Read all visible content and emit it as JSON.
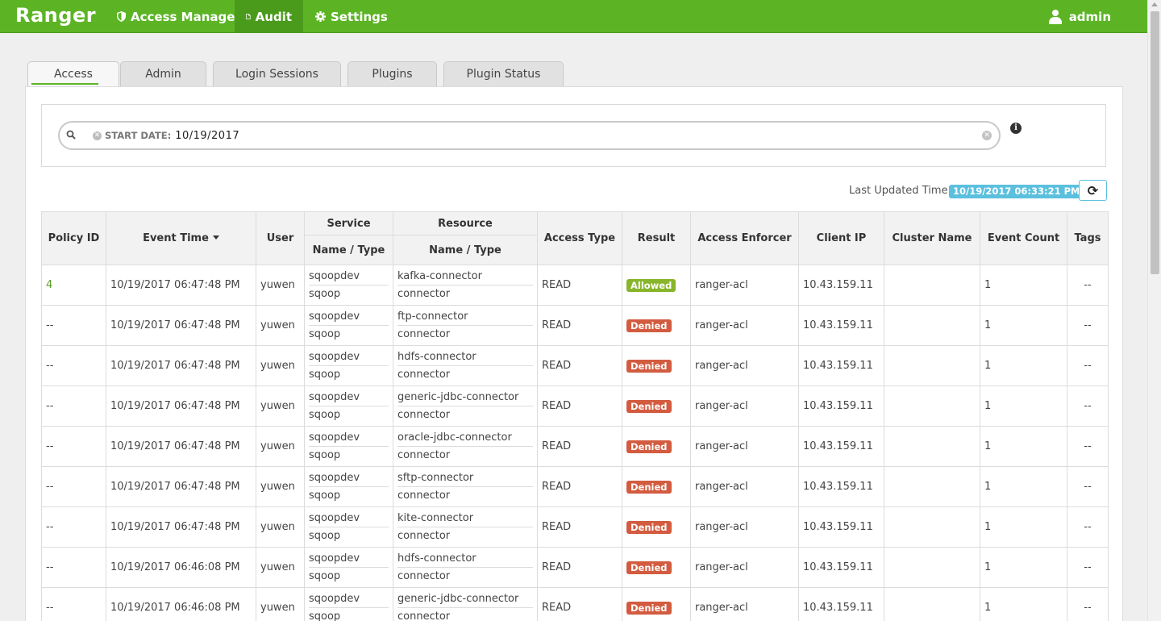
{
  "nav": {
    "brand": "Ranger",
    "items": [
      {
        "label": "Access Manager",
        "icon": "shield-icon"
      },
      {
        "label": "Audit",
        "icon": "file-icon"
      },
      {
        "label": "Settings",
        "icon": "gear-icon"
      }
    ],
    "user": "admin"
  },
  "tabs": [
    "Access",
    "Admin",
    "Login Sessions",
    "Plugins",
    "Plugin Status"
  ],
  "search": {
    "facet_category": "START DATE:",
    "facet_value": "10/19/2017"
  },
  "status": {
    "last_updated_label": "Last Updated Time :",
    "last_updated_value": "10/19/2017 06:33:21 PM"
  },
  "table": {
    "headers": {
      "policy_id": "Policy ID",
      "event_time": "Event Time",
      "user": "User",
      "service": "Service",
      "service_sub": "Name / Type",
      "resource": "Resource",
      "resource_sub": "Name / Type",
      "access_type": "Access Type",
      "result": "Result",
      "access_enforcer": "Access Enforcer",
      "client_ip": "Client IP",
      "cluster_name": "Cluster Name",
      "event_count": "Event Count",
      "tags": "Tags"
    },
    "rows": [
      {
        "policy_id": "4",
        "event_time": "10/19/2017 06:47:48 PM",
        "user": "yuwen",
        "service_name": "sqoopdev",
        "service_type": "sqoop",
        "resource_name": "kafka-connector",
        "resource_type": "connector",
        "access_type": "READ",
        "result": "Allowed",
        "enforcer": "ranger-acl",
        "client_ip": "10.43.159.11",
        "cluster": "",
        "count": "1",
        "tags": "--"
      },
      {
        "policy_id": "--",
        "event_time": "10/19/2017 06:47:48 PM",
        "user": "yuwen",
        "service_name": "sqoopdev",
        "service_type": "sqoop",
        "resource_name": "ftp-connector",
        "resource_type": "connector",
        "access_type": "READ",
        "result": "Denied",
        "enforcer": "ranger-acl",
        "client_ip": "10.43.159.11",
        "cluster": "",
        "count": "1",
        "tags": "--"
      },
      {
        "policy_id": "--",
        "event_time": "10/19/2017 06:47:48 PM",
        "user": "yuwen",
        "service_name": "sqoopdev",
        "service_type": "sqoop",
        "resource_name": "hdfs-connector",
        "resource_type": "connector",
        "access_type": "READ",
        "result": "Denied",
        "enforcer": "ranger-acl",
        "client_ip": "10.43.159.11",
        "cluster": "",
        "count": "1",
        "tags": "--"
      },
      {
        "policy_id": "--",
        "event_time": "10/19/2017 06:47:48 PM",
        "user": "yuwen",
        "service_name": "sqoopdev",
        "service_type": "sqoop",
        "resource_name": "generic-jdbc-connector",
        "resource_type": "connector",
        "access_type": "READ",
        "result": "Denied",
        "enforcer": "ranger-acl",
        "client_ip": "10.43.159.11",
        "cluster": "",
        "count": "1",
        "tags": "--"
      },
      {
        "policy_id": "--",
        "event_time": "10/19/2017 06:47:48 PM",
        "user": "yuwen",
        "service_name": "sqoopdev",
        "service_type": "sqoop",
        "resource_name": "oracle-jdbc-connector",
        "resource_type": "connector",
        "access_type": "READ",
        "result": "Denied",
        "enforcer": "ranger-acl",
        "client_ip": "10.43.159.11",
        "cluster": "",
        "count": "1",
        "tags": "--"
      },
      {
        "policy_id": "--",
        "event_time": "10/19/2017 06:47:48 PM",
        "user": "yuwen",
        "service_name": "sqoopdev",
        "service_type": "sqoop",
        "resource_name": "sftp-connector",
        "resource_type": "connector",
        "access_type": "READ",
        "result": "Denied",
        "enforcer": "ranger-acl",
        "client_ip": "10.43.159.11",
        "cluster": "",
        "count": "1",
        "tags": "--"
      },
      {
        "policy_id": "--",
        "event_time": "10/19/2017 06:47:48 PM",
        "user": "yuwen",
        "service_name": "sqoopdev",
        "service_type": "sqoop",
        "resource_name": "kite-connector",
        "resource_type": "connector",
        "access_type": "READ",
        "result": "Denied",
        "enforcer": "ranger-acl",
        "client_ip": "10.43.159.11",
        "cluster": "",
        "count": "1",
        "tags": "--"
      },
      {
        "policy_id": "--",
        "event_time": "10/19/2017 06:46:08 PM",
        "user": "yuwen",
        "service_name": "sqoopdev",
        "service_type": "sqoop",
        "resource_name": "hdfs-connector",
        "resource_type": "connector",
        "access_type": "READ",
        "result": "Denied",
        "enforcer": "ranger-acl",
        "client_ip": "10.43.159.11",
        "cluster": "",
        "count": "1",
        "tags": "--"
      },
      {
        "policy_id": "--",
        "event_time": "10/19/2017 06:46:08 PM",
        "user": "yuwen",
        "service_name": "sqoopdev",
        "service_type": "sqoop",
        "resource_name": "generic-jdbc-connector",
        "resource_type": "connector",
        "access_type": "READ",
        "result": "Denied",
        "enforcer": "ranger-acl",
        "client_ip": "10.43.159.11",
        "cluster": "",
        "count": "1",
        "tags": "--"
      }
    ]
  },
  "colors": {
    "navbar": "#5cb425",
    "allowed": "#88b52b",
    "denied": "#d35b3f",
    "info": "#5bc0de"
  }
}
